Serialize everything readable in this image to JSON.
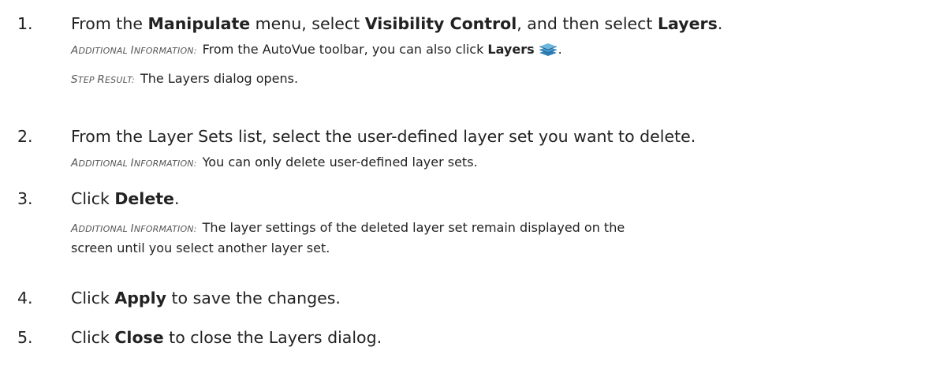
{
  "steps": [
    {
      "number": "1.",
      "parts": [
        "From the ",
        "Manipulate",
        " menu, select ",
        "Visibility Control",
        ", and then select ",
        "Layers",
        "."
      ],
      "additional_info": {
        "label_first": "A",
        "label_first_rest": "DDITIONAL ",
        "label_second": "I",
        "label_second_rest": "NFORMATION:",
        "text_before": "From the AutoVue toolbar, you can also click ",
        "bold": "Layers",
        "icon": "layers-icon",
        "text_after": "."
      },
      "step_result": {
        "label_first": "S",
        "label_first_rest": "TEP ",
        "label_second": "R",
        "label_second_rest": "ESULT:",
        "text": "The Layers dialog opens."
      }
    },
    {
      "number": "2.",
      "text": "From the Layer Sets list, select the user-defined layer set you want to delete.",
      "additional_info": {
        "text": "You can only delete user-defined layer sets."
      }
    },
    {
      "number": "3.",
      "parts": [
        "Click ",
        "Delete",
        "."
      ],
      "additional_info": {
        "text_line1": "The layer settings of the deleted layer set remain displayed on the",
        "text_line2": "screen until you select another layer set."
      }
    },
    {
      "number": "4.",
      "parts": [
        "Click ",
        "Apply",
        " to save the changes."
      ]
    },
    {
      "number": "5.",
      "parts": [
        "Click ",
        "Close",
        " to close the Layers dialog."
      ]
    }
  ],
  "colors": {
    "text": "#222222",
    "label": "#555555",
    "icon_top": "#5aa9d6",
    "icon_bottom": "#2f7fb8"
  }
}
